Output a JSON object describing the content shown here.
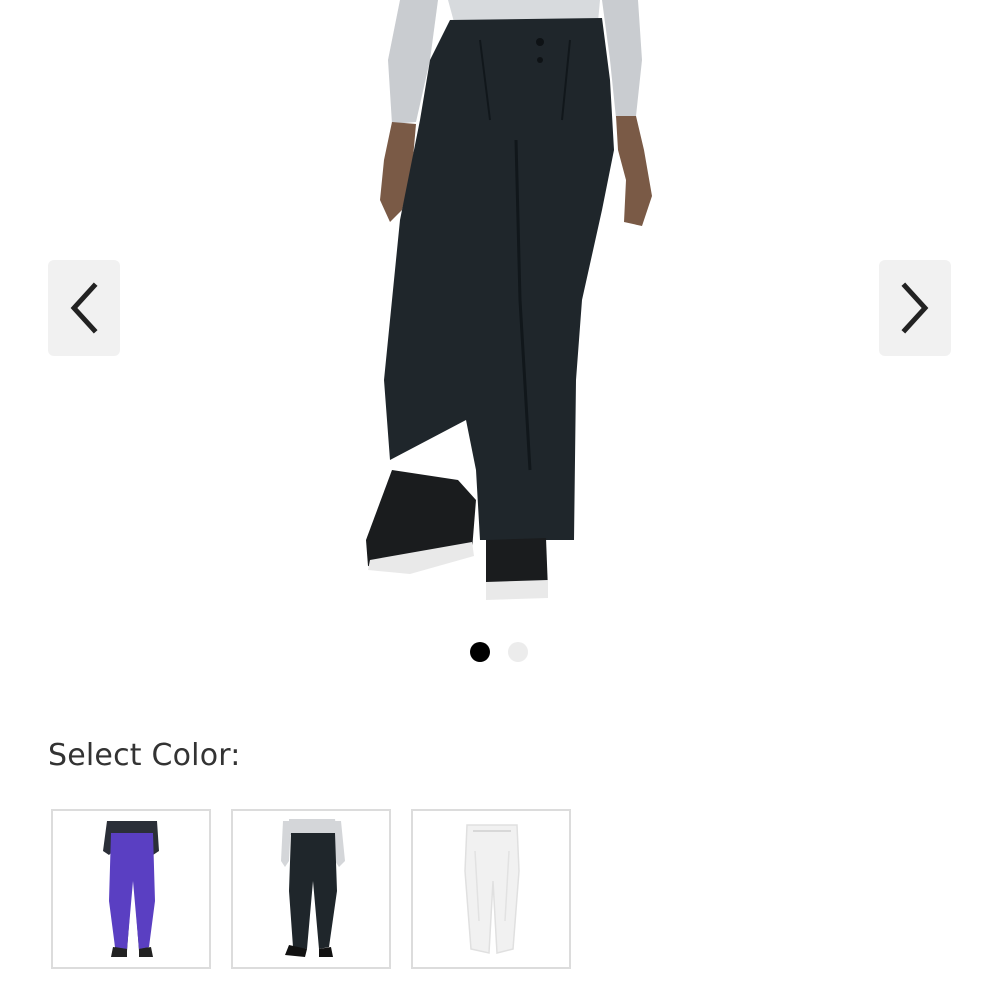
{
  "carousel": {
    "prev_icon": "chevron-left-icon",
    "next_icon": "chevron-right-icon",
    "slides": [
      {
        "active": true
      },
      {
        "active": false
      }
    ]
  },
  "color_selector": {
    "label": "Select Color:",
    "options": [
      {
        "icon": "pants-thumbnail-purple",
        "color": "#5a3fc2"
      },
      {
        "icon": "pants-thumbnail-black",
        "color": "#1f262b"
      },
      {
        "icon": "pants-thumbnail-white",
        "color": "#f1f1f1"
      }
    ]
  },
  "colors": {
    "nav_button_bg": "#f1f1f1",
    "dot_active": "#000000",
    "dot_inactive": "#ececec",
    "label_text": "#333333",
    "swatch_border": "#dcdcdc"
  }
}
